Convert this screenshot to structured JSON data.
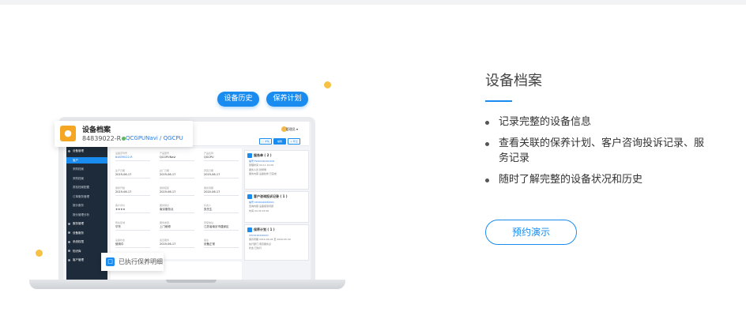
{
  "section": {
    "title": "设备档案",
    "features": [
      "记录完整的设备信息",
      "查看关联的保养计划、客户咨询投诉记录、服",
      "务记录",
      "随时了解完整的设备状况和历史"
    ],
    "demo_button": "预约演示",
    "accent_color": "#1a8cf0"
  },
  "illustration": {
    "tab_history": "设备历史",
    "tab_plan": "保养计划",
    "card": {
      "title": "设备档案",
      "equipment_id": "84839022-R",
      "model": "QCGPUNavi / QGCPU",
      "avatar_icon": "user-icon"
    },
    "executed_label": "已执行保养明细",
    "app": {
      "user_name": "管理员 ▾",
      "header_btn_1": "□ 详情",
      "header_btn_2": "编辑",
      "header_btn_3": "◎ 导出",
      "sidebar": [
        {
          "label": "设备管理",
          "type": "head"
        },
        {
          "label": "客户",
          "type": "active"
        },
        {
          "label": "采购档案",
          "type": "item"
        },
        {
          "label": "采购档案",
          "type": "item"
        },
        {
          "label": "质检档案配置",
          "type": "item"
        },
        {
          "label": "订单服务管理",
          "type": "item"
        },
        {
          "label": "报价服务",
          "type": "item"
        },
        {
          "label": "报价管理分析",
          "type": "item"
        },
        {
          "label": "服务管理",
          "type": "head"
        },
        {
          "label": "设备服务",
          "type": "head"
        },
        {
          "label": "系统权限",
          "type": "head"
        },
        {
          "label": "知识库",
          "type": "head"
        },
        {
          "label": "客户管理",
          "type": "head"
        }
      ],
      "fields": [
        {
          "label": "设备序列号",
          "value": "84839022-R",
          "blue": true
        },
        {
          "label": "产品型号",
          "value": "QCGPUNavi",
          "blue": false
        },
        {
          "label": "产品名称",
          "value": "QGCPU",
          "blue": false
        },
        {
          "label": "生产日期",
          "value": "2019-06-17",
          "blue": false
        },
        {
          "label": "出厂日期",
          "value": "2019-06-17",
          "blue": false
        },
        {
          "label": "安装日期",
          "value": "2019-06-17",
          "blue": false
        },
        {
          "label": "保修开始",
          "value": "2019-06-17",
          "blue": false
        },
        {
          "label": "保修结束",
          "value": "2019-06-17",
          "blue": false
        },
        {
          "label": "服务到期",
          "value": "2020-06-17",
          "blue": false
        },
        {
          "label": "客户评价",
          "value": "★★★★",
          "blue": false
        },
        {
          "label": "服务网点",
          "value": "南京服务点",
          "blue": false
        },
        {
          "label": "负责人",
          "value": "张先生",
          "blue": false
        },
        {
          "label": "所在区域",
          "value": "华东",
          "blue": false
        },
        {
          "label": "服务类型",
          "value": "上门维修",
          "blue": false
        },
        {
          "label": "安装地址",
          "value": "江苏省南京市建邺区",
          "blue": false
        },
        {
          "label": "设备状态",
          "value": "使用中",
          "blue": false
        },
        {
          "label": "最近服务",
          "value": "2019-06-17",
          "blue": false
        },
        {
          "label": "备注",
          "value": "设备正常",
          "blue": false
        }
      ],
      "right_cards": [
        {
          "title": "服务单 ( 2 )",
          "lines": [
            "编号 FW20190401001",
            "受理时间 04-11 10:00",
            "服务人员 张师傅",
            "服务内容 设备检修 已完成"
          ]
        },
        {
          "title": "客户咨询投诉记录 ( 1 )",
          "lines": [
            "编号 CP20190430001",
            "咨询内容 设备使用问题",
            "时间 04-30 15:00"
          ]
        },
        {
          "title": "保养计划 ( 1 )",
          "lines": [
            "CP20190430001",
            "保养周期 2019-06-04 至 2020-05-30",
            "执行部门 南京服务点",
            "状态 已执行"
          ]
        }
      ]
    }
  }
}
